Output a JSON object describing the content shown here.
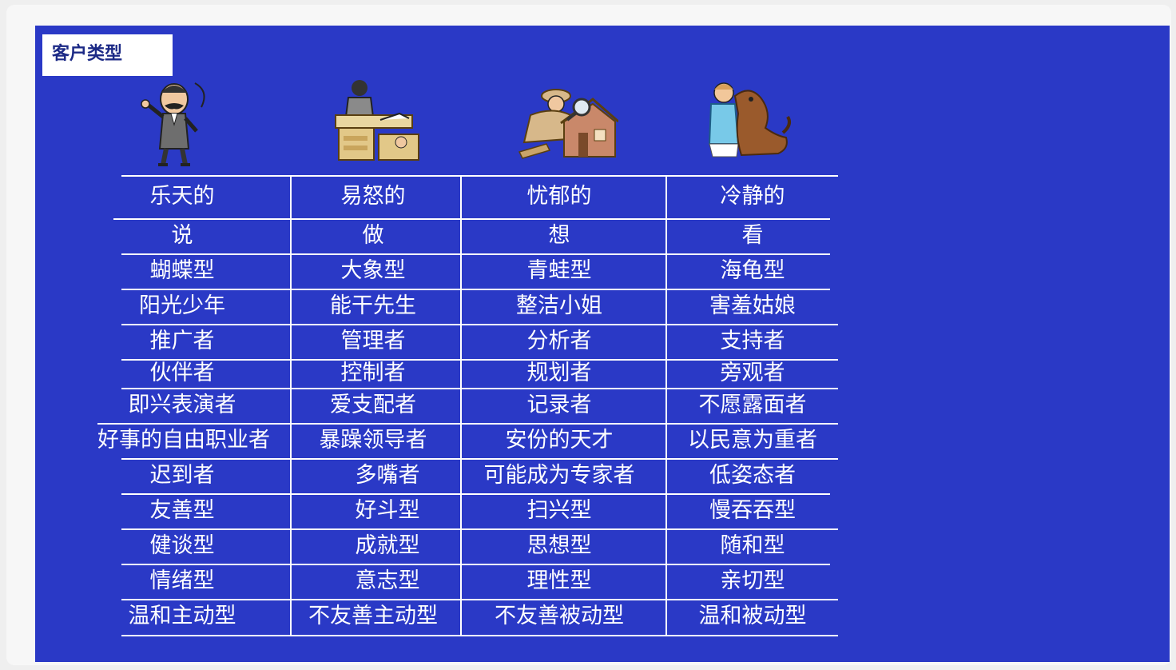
{
  "slide": {
    "title": "客户类型",
    "illustrations": [
      {
        "icon": "cheerful-man-clipart"
      },
      {
        "icon": "office-worker-at-desk-clipart"
      },
      {
        "icon": "detective-with-magnifier-house-clipart"
      },
      {
        "icon": "person-hugging-dog-clipart"
      }
    ]
  },
  "table": {
    "columns": [
      "乐天的",
      "易怒的",
      "忧郁的",
      "冷静的"
    ],
    "rows": [
      [
        "说",
        "做",
        "想",
        "看"
      ],
      [
        "蝴蝶型",
        "大象型",
        "青蛙型",
        "海龟型"
      ],
      [
        "阳光少年",
        "能干先生",
        "整洁小姐",
        "害羞姑娘"
      ],
      [
        "推广者",
        "管理者",
        "分析者",
        "支持者"
      ],
      [
        "伙伴者",
        "控制者",
        "规划者",
        "旁观者"
      ],
      [
        "即兴表演者",
        "爱支配者",
        "记录者",
        "不愿露面者"
      ],
      [
        "好事的自由职业者",
        "暴躁领导者",
        "安份的天才",
        "以民意为重者"
      ],
      [
        "迟到者",
        "多嘴者",
        "可能成为专家者",
        "低姿态者"
      ],
      [
        "友善型",
        "好斗型",
        "扫兴型",
        "慢吞吞型"
      ],
      [
        "健谈型",
        "成就型",
        "思想型",
        "随和型"
      ],
      [
        "情绪型",
        "意志型",
        "理性型",
        "亲切型"
      ],
      [
        "温和主动型",
        "不友善主动型",
        "不友善被动型",
        "温和被动型"
      ]
    ]
  },
  "colors": {
    "slide_background": "#2a39c6",
    "text": "#ffffff",
    "title_text": "#1c2a86"
  }
}
